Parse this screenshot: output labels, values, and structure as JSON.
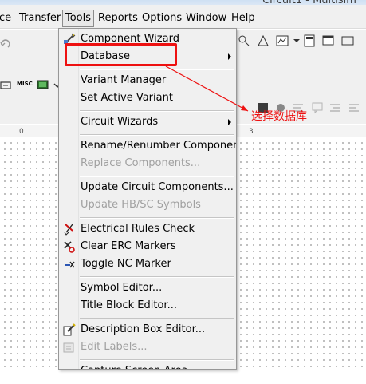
{
  "window": {
    "title": "Circuit1 - Multisim"
  },
  "menubar": {
    "items": [
      {
        "label": "ce"
      },
      {
        "label": "Transfer"
      },
      {
        "label": "Tools"
      },
      {
        "label": "Reports"
      },
      {
        "label": "Options"
      },
      {
        "label": "Window"
      },
      {
        "label": "Help"
      }
    ]
  },
  "toolbar": {
    "misc_label": "MISC"
  },
  "ruler": {
    "marks": [
      "0",
      "3"
    ]
  },
  "tools_menu": {
    "items": [
      {
        "label": "Component Wizard",
        "icon": "component-wizard-icon"
      },
      {
        "label": "Database",
        "has_submenu": true
      },
      {
        "label": "Variant Manager"
      },
      {
        "label": "Set Active Variant"
      },
      {
        "label": "Circuit Wizards",
        "has_submenu": true
      },
      {
        "label": "Rename/Renumber Components"
      },
      {
        "label": "Replace Components...",
        "disabled": true
      },
      {
        "label": "Update Circuit Components..."
      },
      {
        "label": "Update HB/SC Symbols",
        "disabled": true
      },
      {
        "label": "Electrical Rules Check",
        "icon": "erc-check-icon"
      },
      {
        "label": "Clear ERC Markers",
        "icon": "clear-erc-icon"
      },
      {
        "label": "Toggle NC Marker",
        "icon": "nc-marker-icon"
      },
      {
        "label": "Symbol Editor..."
      },
      {
        "label": "Title Block Editor..."
      },
      {
        "label": "Description Box Editor...",
        "icon": "description-box-icon"
      },
      {
        "label": "Edit Labels...",
        "disabled": true,
        "icon": "edit-labels-icon"
      },
      {
        "label": "Capture Screen Area"
      }
    ]
  },
  "annotation": {
    "text": "选择数据库",
    "color": "#ee1111"
  }
}
